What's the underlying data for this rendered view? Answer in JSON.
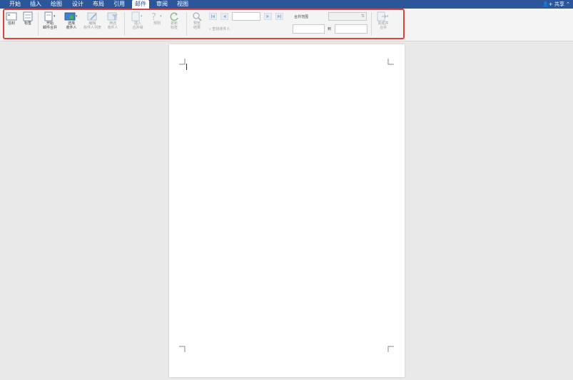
{
  "tabs": [
    {
      "label": "开始",
      "active": false
    },
    {
      "label": "插入",
      "active": false
    },
    {
      "label": "绘图",
      "active": false
    },
    {
      "label": "设计",
      "active": false
    },
    {
      "label": "布局",
      "active": false
    },
    {
      "label": "引用",
      "active": false
    },
    {
      "label": "邮件",
      "active": true
    },
    {
      "label": "审阅",
      "active": false
    },
    {
      "label": "视图",
      "active": false
    }
  ],
  "share_label": "共享",
  "ribbon": {
    "envelope": "信封",
    "labels": "标签",
    "start_merge": [
      "开始",
      "邮件合并"
    ],
    "select_recipients": [
      "选择",
      "收件人"
    ],
    "edit_recipients": [
      "编辑",
      "收件人列表"
    ],
    "filter_recipients": [
      "筛选",
      "收件人"
    ],
    "insert_merge_field": [
      "插入",
      "合并域"
    ],
    "rules": "规则",
    "update_labels": [
      "更新",
      "标签"
    ],
    "preview_results": [
      "预览",
      "结果"
    ],
    "find_recipient": "查找收件人",
    "record_value": "",
    "merge_range": "合并范围",
    "range_select_value": "",
    "range_from": "",
    "range_to_label": "到",
    "range_to": "",
    "finish_merge": [
      "完成并",
      "合并"
    ]
  },
  "colors": {
    "ribbon_accent": "#2b579a",
    "highlight": "#e0403f"
  }
}
